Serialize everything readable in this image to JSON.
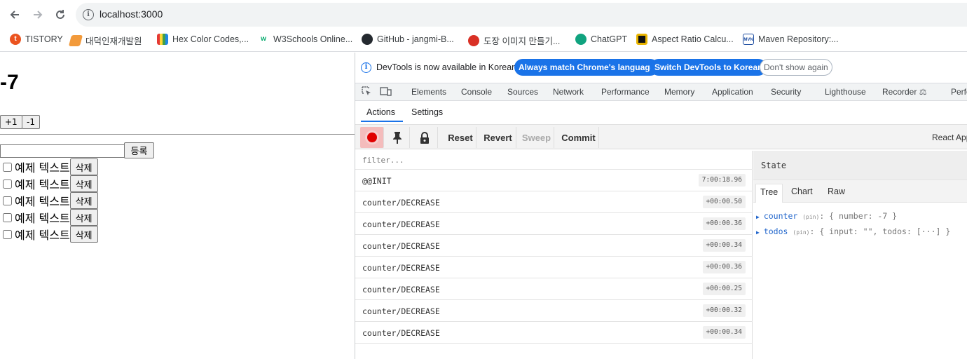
{
  "browser": {
    "url": "localhost:3000",
    "bookmarks": [
      {
        "label": "TISTORY",
        "icon": "tistory-icon",
        "color": "#eb531f"
      },
      {
        "label": "대덕인재개발원",
        "icon": "dd-icon",
        "color": "#f29a3b"
      },
      {
        "label": "Hex Color Codes,...",
        "icon": "hex-icon",
        "color": "#4a7ee0"
      },
      {
        "label": "W3Schools Online...",
        "icon": "w3-icon",
        "color": "#04aa6d"
      },
      {
        "label": "GitHub - jangmi-B...",
        "icon": "github-icon",
        "color": "#24292f"
      },
      {
        "label": "도장 이미지 만들기...",
        "icon": "stamp-icon",
        "color": "#d93025"
      },
      {
        "label": "ChatGPT",
        "icon": "chatgpt-icon",
        "color": "#10a37f"
      },
      {
        "label": "Aspect Ratio Calcu...",
        "icon": "aspect-icon",
        "color": "#e8b400"
      },
      {
        "label": "Maven Repository:...",
        "icon": "maven-icon",
        "color": "#1f4ea1"
      }
    ]
  },
  "app": {
    "counter_value": "-7",
    "plus_label": "+1",
    "minus_label": "-1",
    "input_value": "",
    "register_label": "등록",
    "todos": [
      {
        "text": "예제 텍스트",
        "delete_label": "삭제"
      },
      {
        "text": "예제 텍스트",
        "delete_label": "삭제"
      },
      {
        "text": "예제 텍스트",
        "delete_label": "삭제"
      },
      {
        "text": "예제 텍스트",
        "delete_label": "삭제"
      },
      {
        "text": "예제 텍스트",
        "delete_label": "삭제"
      }
    ]
  },
  "devtools": {
    "infobar": {
      "message": "DevTools is now available in Korean!",
      "btn_match": "Always match Chrome's language",
      "btn_switch": "Switch DevTools to Korean",
      "btn_dismiss": "Don't show again"
    },
    "tabs": [
      "Elements",
      "Console",
      "Sources",
      "Network",
      "Performance",
      "Memory",
      "Application",
      "Security",
      "Lighthouse",
      "Recorder",
      "Perfo"
    ],
    "subtabs": [
      "Actions",
      "Settings"
    ],
    "toolbar": {
      "reset": "Reset",
      "revert": "Revert",
      "sweep": "Sweep",
      "commit": "Commit",
      "react_label": "React App"
    },
    "filter_placeholder": "filter...",
    "actions": [
      {
        "name": "@@INIT",
        "time": "7:00:18.96"
      },
      {
        "name": "counter/DECREASE",
        "time": "+00:00.50"
      },
      {
        "name": "counter/DECREASE",
        "time": "+00:00.36"
      },
      {
        "name": "counter/DECREASE",
        "time": "+00:00.34"
      },
      {
        "name": "counter/DECREASE",
        "time": "+00:00.36"
      },
      {
        "name": "counter/DECREASE",
        "time": "+00:00.25"
      },
      {
        "name": "counter/DECREASE",
        "time": "+00:00.32"
      },
      {
        "name": "counter/DECREASE",
        "time": "+00:00.34"
      }
    ],
    "state": {
      "header": "State",
      "tabs": [
        "Tree",
        "Chart",
        "Raw"
      ],
      "tree": [
        {
          "key": "counter",
          "pin": "(pin)",
          "value": ": { number: -7 }"
        },
        {
          "key": "todos",
          "pin": "(pin)",
          "value": ": { input: \"\", todos: [···] }"
        }
      ]
    }
  }
}
